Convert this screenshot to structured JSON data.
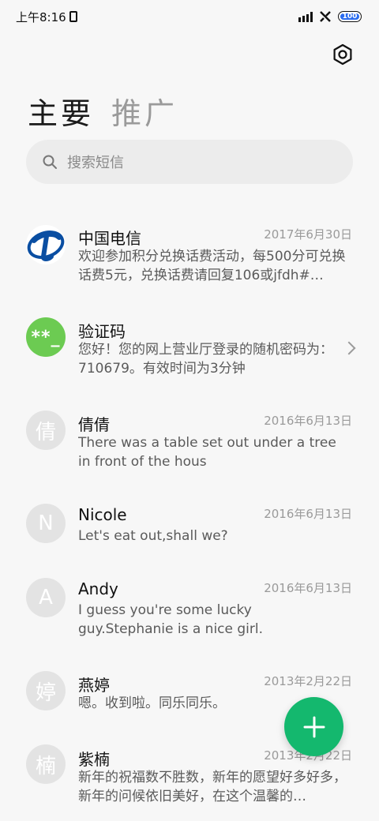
{
  "status_bar": {
    "time": "上午8:16",
    "battery": "100"
  },
  "tabs": [
    {
      "label": "主要",
      "active": true
    },
    {
      "label": "推广",
      "active": false
    }
  ],
  "search": {
    "placeholder": "搜索短信"
  },
  "conversations": [
    {
      "avatar": "telecom-logo",
      "name": "中国电信",
      "date": "2017年6月30日",
      "preview": "欢迎参加积分兑换话费活动，每500分可兑换话费5元，兑换话费请回复106或jfdh#…"
    },
    {
      "avatar": "**_",
      "name": "验证码",
      "date": "",
      "preview": "您好！您的网上营业厅登录的随机密码为：710679。有效时间为3分钟"
    },
    {
      "avatar": "倩",
      "name": "倩倩",
      "date": "2016年6月13日",
      "preview": "There was a table set out under a tree in front of the hous"
    },
    {
      "avatar": "N",
      "name": "Nicole",
      "date": "2016年6月13日",
      "preview": "Let's eat out,shall we?"
    },
    {
      "avatar": "A",
      "name": "Andy",
      "date": "2016年6月13日",
      "preview": "I guess you're some lucky guy.Stephanie is a nice girl."
    },
    {
      "avatar": "婷",
      "name": "燕婷",
      "date": "2013年2月22日",
      "preview": "嗯。收到啦。同乐同乐。"
    },
    {
      "avatar": "楠",
      "name": "紫楠",
      "date": "2013年2月22日",
      "preview": "新年的祝福数不胜数，新年的愿望好多好多，新年的问候依旧美好，在这个温馨的…"
    }
  ],
  "colors": {
    "fab": "#14b86e",
    "verify_avatar": "#6ccb52",
    "telecom_blue": "#0a4ea2"
  }
}
